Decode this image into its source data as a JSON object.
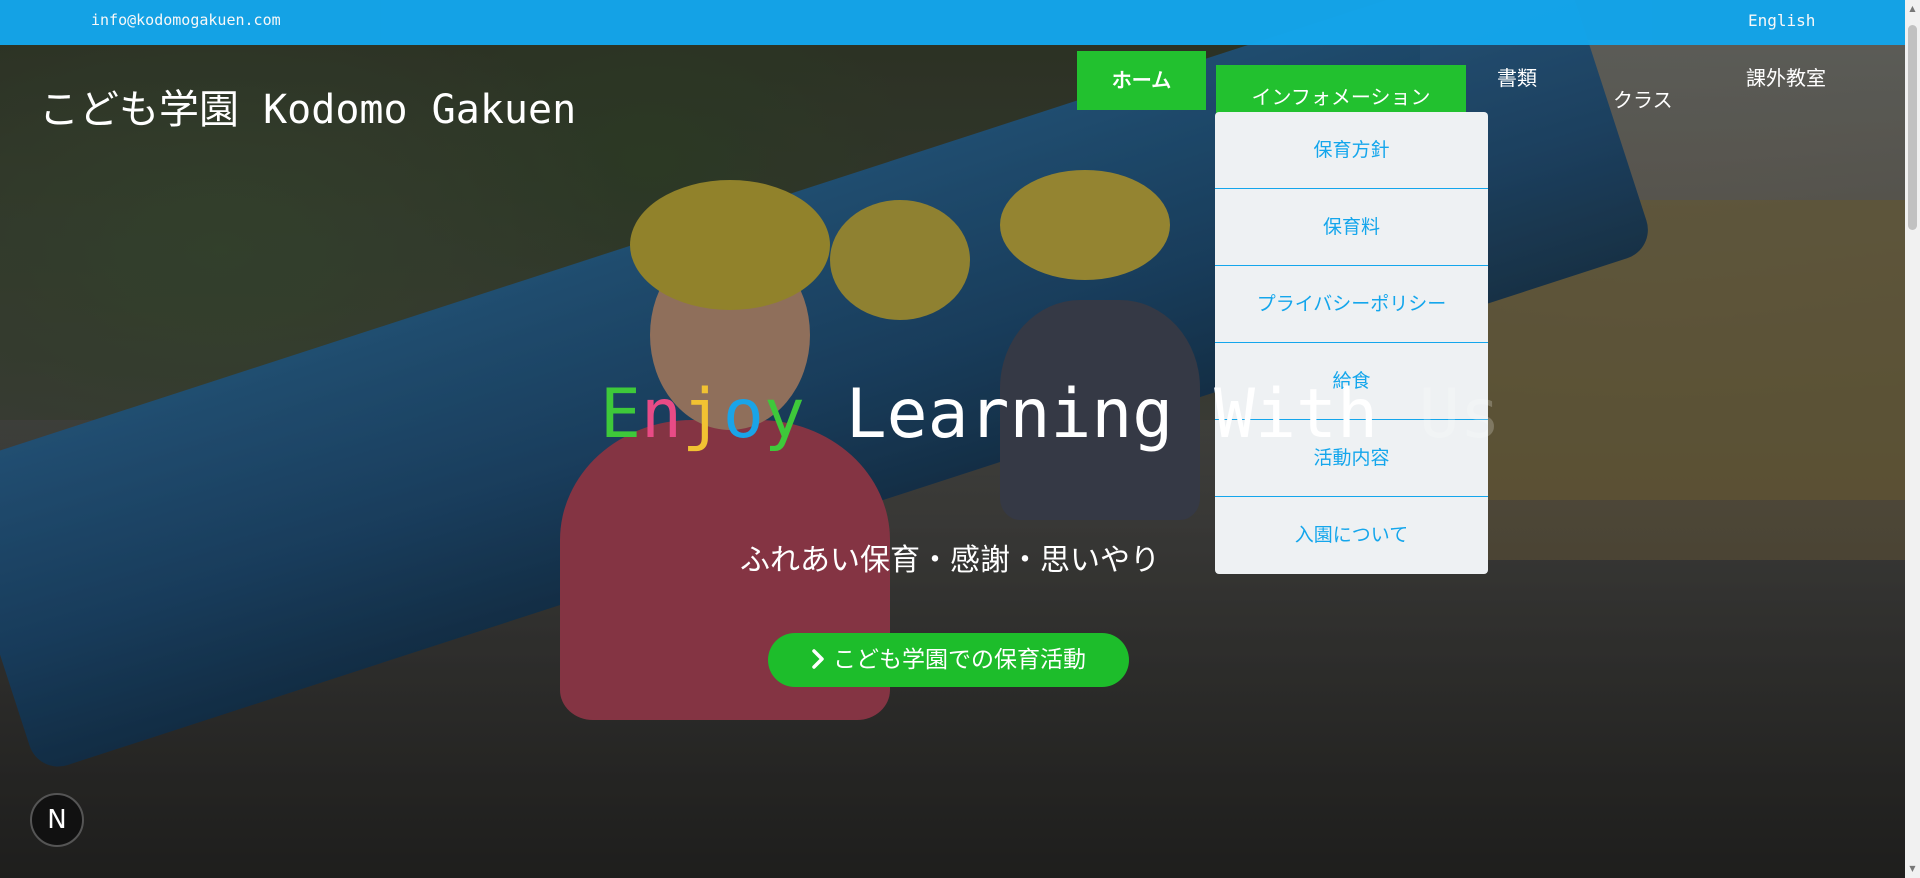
{
  "topbar": {
    "email": "info@kodomogakuen.com",
    "language": "English"
  },
  "brand": "こども学園 Kodomo Gakuen",
  "nav": {
    "home": "ホーム",
    "information": "インフォメーション",
    "documents": "書類",
    "classes": "クラス",
    "extracurricular": "課外教室"
  },
  "dropdown": {
    "items": [
      "保育方針",
      "保育料",
      "プライバシーポリシー",
      "給食",
      "活動内容",
      "入園について"
    ]
  },
  "hero": {
    "headline_letters": [
      "E",
      "n",
      "j",
      "o",
      "y"
    ],
    "headline_rest_visible": " Learning With ",
    "headline_rest_faded": "Us",
    "tagline": "ふれあい保育・感謝・思いやり",
    "cta_label": "こども学園での保育活動"
  },
  "badge": {
    "label": "N"
  },
  "colors": {
    "topbar": "#14a6ec",
    "nav_green": "#22c12f",
    "cta_green": "#1dbd2b",
    "dropdown_text": "#14a6ec",
    "enjoy_e": "#3ec93a",
    "enjoy_n": "#e84b86",
    "enjoy_j": "#f1c232",
    "enjoy_o": "#19a4e8",
    "enjoy_y": "#3ec93a"
  },
  "icons": {
    "cta": "chevron-right-icon",
    "scroll_up": "arrow-up-icon",
    "scroll_down": "arrow-down-icon"
  }
}
